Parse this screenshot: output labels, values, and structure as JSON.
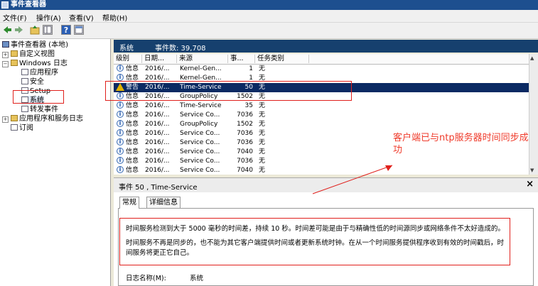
{
  "window": {
    "title": "事件查看器"
  },
  "menu": [
    "文件(F)",
    "操作(A)",
    "查看(V)",
    "帮助(H)"
  ],
  "toolbar": {
    "back_icon": "arrow-left-icon",
    "forward_icon": "arrow-right-icon",
    "up_icon": "folder-up-icon",
    "tree_icon": "show-tree-icon",
    "help_icon": "help-icon",
    "props_icon": "properties-icon",
    "help_glyph": "?"
  },
  "tree": {
    "root": "事件查看器 (本地)",
    "custom_views": "自定义视图",
    "windows_logs": "Windows 日志",
    "application": "应用程序",
    "security": "安全",
    "setup": "Setup",
    "system": "系统",
    "forwarded": "转发事件",
    "app_services": "应用程序和服务日志",
    "subscriptions": "订阅",
    "expand_plus": "+",
    "expand_minus": "−"
  },
  "list": {
    "title": "系统",
    "count_label": "事件数: 39,708",
    "columns": [
      "级别",
      "日期...",
      "来源",
      "事...",
      "任务类别"
    ],
    "rows": [
      {
        "level": "信息",
        "date": "2016/...",
        "source": "Kernel-Gen...",
        "id": "1",
        "task": "无",
        "type": "info"
      },
      {
        "level": "信息",
        "date": "2016/...",
        "source": "Kernel-Gen...",
        "id": "1",
        "task": "无",
        "type": "info"
      },
      {
        "level": "警告",
        "date": "2016/...",
        "source": "Time-Service",
        "id": "50",
        "task": "无",
        "type": "warn"
      },
      {
        "level": "信息",
        "date": "2016/...",
        "source": "GroupPolicy",
        "id": "1502",
        "task": "无",
        "type": "info"
      },
      {
        "level": "信息",
        "date": "2016/...",
        "source": "Time-Service",
        "id": "35",
        "task": "无",
        "type": "info"
      },
      {
        "level": "信息",
        "date": "2016/...",
        "source": "Service Co...",
        "id": "7036",
        "task": "无",
        "type": "info"
      },
      {
        "level": "信息",
        "date": "2016/...",
        "source": "GroupPolicy",
        "id": "1502",
        "task": "无",
        "type": "info"
      },
      {
        "level": "信息",
        "date": "2016/...",
        "source": "Service Co...",
        "id": "7036",
        "task": "无",
        "type": "info"
      },
      {
        "level": "信息",
        "date": "2016/...",
        "source": "Service Co...",
        "id": "7036",
        "task": "无",
        "type": "info"
      },
      {
        "level": "信息",
        "date": "2016/...",
        "source": "Service Co...",
        "id": "7040",
        "task": "无",
        "type": "info"
      },
      {
        "level": "信息",
        "date": "2016/...",
        "source": "Service Co...",
        "id": "7036",
        "task": "无",
        "type": "info"
      },
      {
        "level": "信息",
        "date": "2016/...",
        "source": "Service Co...",
        "id": "7040",
        "task": "无",
        "type": "info"
      }
    ],
    "scroll_up": "▲",
    "scroll_down": "▼"
  },
  "detail": {
    "title": "事件 50 , Time-Service",
    "close": "×",
    "tab_general": "常规",
    "tab_details": "详细信息",
    "line1": "时间服务检测到大于 5000 毫秒的时间差，持续 10 秒。时间差可能是由于与精确性低的时间源同步或网络条件不太好造成的。",
    "line2": "时间服务不再是同步的，也不能为其它客户端提供时间或者更新系统时钟。在从一个时间服务提供程序收到有效的时间戳后，时",
    "line3": "间服务将更正它自己。",
    "log_name_label": "日志名称(M):",
    "log_name_value": "系统"
  },
  "annotation": {
    "text": "客户端已与ntp服务器时间同步成功",
    "color": "#ef3a2a"
  },
  "colors": {
    "title_bar": "#1d4f8f",
    "list_header": "#16406e",
    "selected_row": "#0b2a63",
    "annotation_red": "#e0201c"
  }
}
